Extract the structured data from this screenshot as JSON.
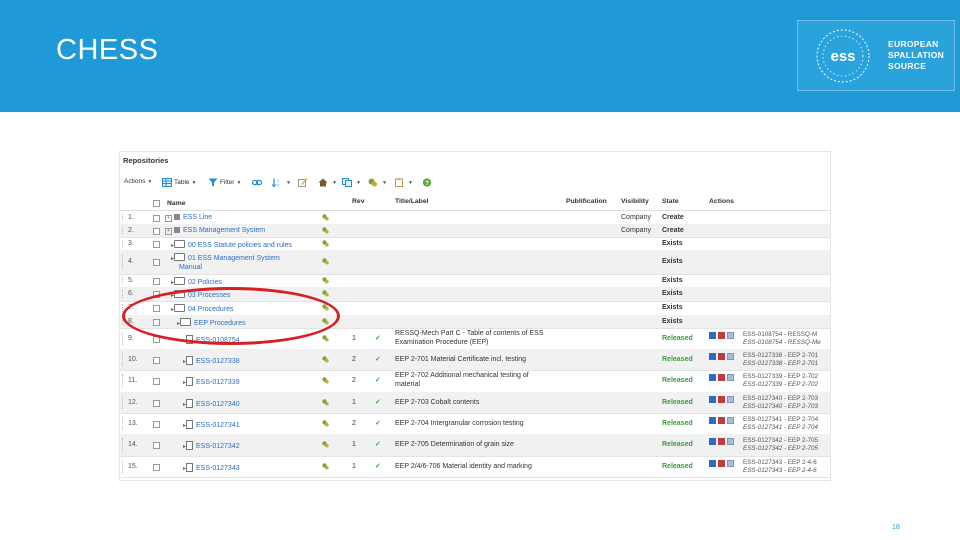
{
  "slide": {
    "title": "CHESS",
    "page_number": "18"
  },
  "logo": {
    "lines": [
      "EUROPEAN",
      "SPALLATION",
      "SOURCE"
    ],
    "mark": "ess"
  },
  "app": {
    "heading": "Repositories",
    "toolbar": {
      "actions": "Actions",
      "table": "Table",
      "filter": "Filter",
      "sort_icon": "sort-icon"
    },
    "columns": {
      "name": "Name",
      "rev": "Rev",
      "title": "Title/Label",
      "publification": "Publification",
      "visibility": "Visibility",
      "state": "State",
      "actions": "Actions"
    },
    "rows": [
      {
        "num": "1.",
        "name": "ESS Line",
        "visibility": "Company",
        "state": "Create"
      },
      {
        "num": "2.",
        "name": "ESS Management System",
        "visibility": "Company",
        "state": "Create"
      },
      {
        "num": "3.",
        "name": "00 ESS Statute policies and rules",
        "state": "Exists"
      },
      {
        "num": "4.",
        "name": "01 ESS Management System",
        "name2": "Manual",
        "state": "Exists"
      },
      {
        "num": "5.",
        "name": "02 Policies",
        "state": "Exists"
      },
      {
        "num": "6.",
        "name": "03 Processes",
        "state": "Exists"
      },
      {
        "num": "7.",
        "name": "04 Procedures",
        "state": "Exists"
      },
      {
        "num": "8.",
        "name": "EEP Procedures",
        "state": "Exists"
      },
      {
        "num": "9.",
        "name": "ESS-0108754",
        "rev": "1",
        "title": "RESSQ-Mech Part C - Table of contents of ESS",
        "title2": "Examination Procedure (EEP)",
        "state": "Released",
        "ref1": "ESS-0108754 - RESSQ-M",
        "ref2": "ESS-0108754 - RESSQ-Me"
      },
      {
        "num": "10.",
        "name": "ESS-0127338",
        "rev": "2",
        "title": "EEP 2-701 Material Certificate incl. testing",
        "title2": "",
        "state": "Released",
        "ref1": "ESS-0127338 - EEP 2-701",
        "ref2": "ESS-0127338 - EEP 2-701"
      },
      {
        "num": "11.",
        "name": "ESS-0127339",
        "rev": "2",
        "title": "EEP 2-702 Additional mechanical testing of",
        "title2": "material",
        "state": "Released",
        "ref1": "ESS-0127339 - EEP 2-702",
        "ref2": "ESS-0127339 - EEP 2-702"
      },
      {
        "num": "12.",
        "name": "ESS-0127340",
        "rev": "1",
        "title": "EEP 2-703 Cobalt contents",
        "title2": "",
        "state": "Released",
        "ref1": "ESS-0127340 - EEP 2-703",
        "ref2": "ESS-0127340 - EEP 2-703"
      },
      {
        "num": "13.",
        "name": "ESS-0127341",
        "rev": "2",
        "title": "EEP 2-704 Intergranular corrosion testing",
        "title2": "",
        "state": "Released",
        "ref1": "ESS-0127341 - EEP 2-704",
        "ref2": "ESS-0127341 - EEP 2-704"
      },
      {
        "num": "14.",
        "name": "ESS-0127342",
        "rev": "1",
        "title": "EEP 2-705 Determination of grain size",
        "title2": "",
        "state": "Released",
        "ref1": "ESS-0127342 - EEP 2-705",
        "ref2": "ESS-0127342 - EEP 2-705"
      },
      {
        "num": "15.",
        "name": "ESS-0127343",
        "rev": "1",
        "title": "EEP 2/4/6-706 Material identity and marking",
        "title2": "",
        "state": "Released",
        "ref1": "ESS-0127343 - EEP 2-4-6",
        "ref2": "ESS-0127343 - EEP 2-4-6"
      }
    ]
  },
  "colors": {
    "banner": "#1f9ad6",
    "link": "#2a6fc4",
    "released": "#3a9a3a",
    "highlight_oval": "#d71f26"
  }
}
